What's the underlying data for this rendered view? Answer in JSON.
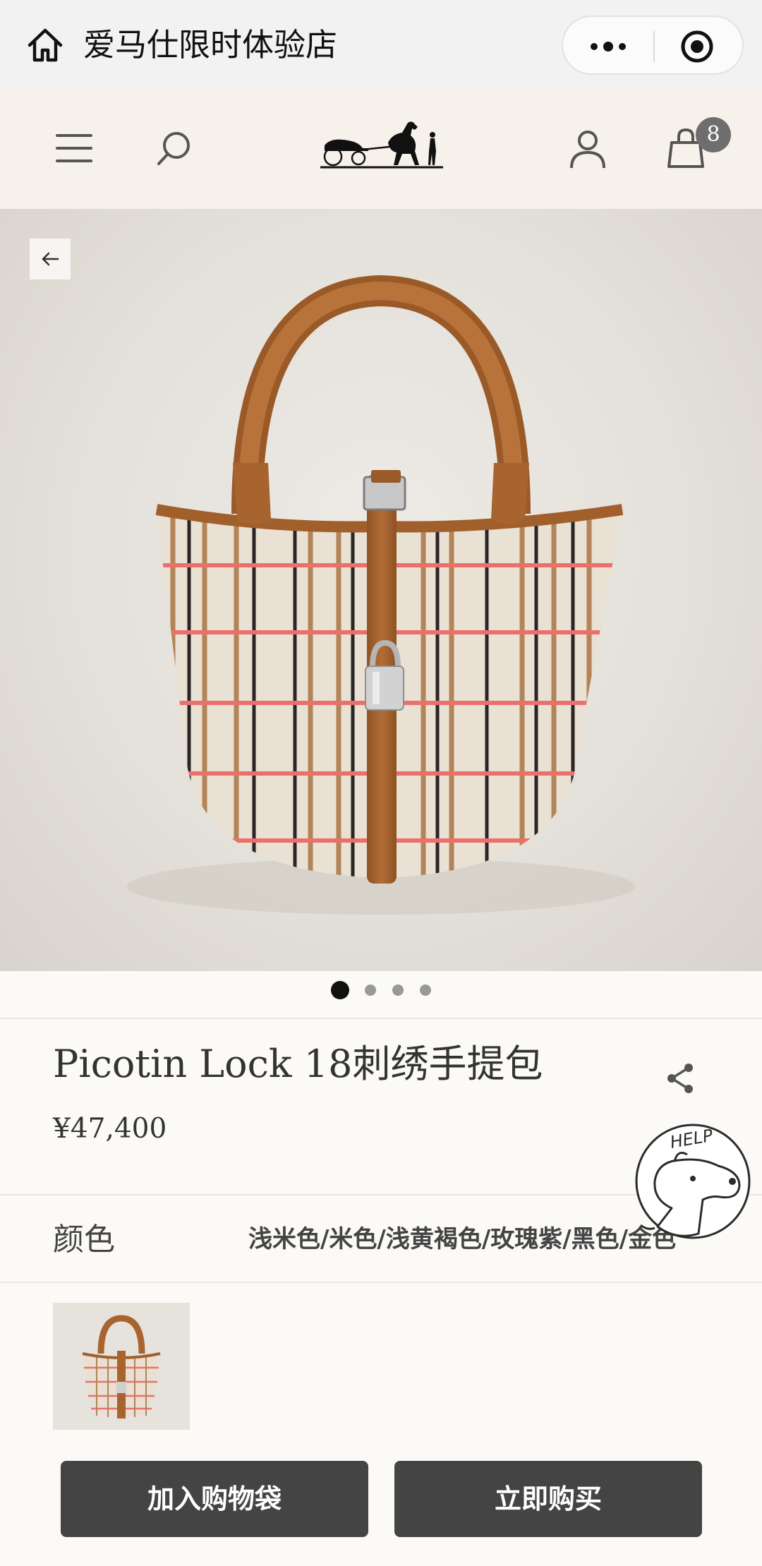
{
  "mini_program": {
    "title": "爱马仕限时体验店",
    "icons": [
      "home-icon",
      "more-dots-icon",
      "close-target-icon"
    ]
  },
  "header": {
    "cart_count": "8",
    "icons": [
      "menu-icon",
      "search-icon",
      "hermes-logo",
      "account-icon",
      "cart-icon"
    ]
  },
  "gallery": {
    "image": "picotin-lock-bag-photo",
    "page_count": 4,
    "active_index": 0
  },
  "product": {
    "name": "Picotin Lock 18刺绣手提包",
    "price": "¥47,400"
  },
  "color": {
    "label": "颜色",
    "value": "浅米色/米色/浅黄褐色/玫瑰紫/黑色/金色"
  },
  "actions": {
    "add_to_bag": "加入购物袋",
    "buy_now": "立即购买"
  },
  "help_badge": {
    "text": "HELP"
  },
  "colors": {
    "button_bg": "#444444",
    "page_bg": "#fcfaf6",
    "header_bg": "#f6f1eb",
    "leather": "#a8642f"
  }
}
